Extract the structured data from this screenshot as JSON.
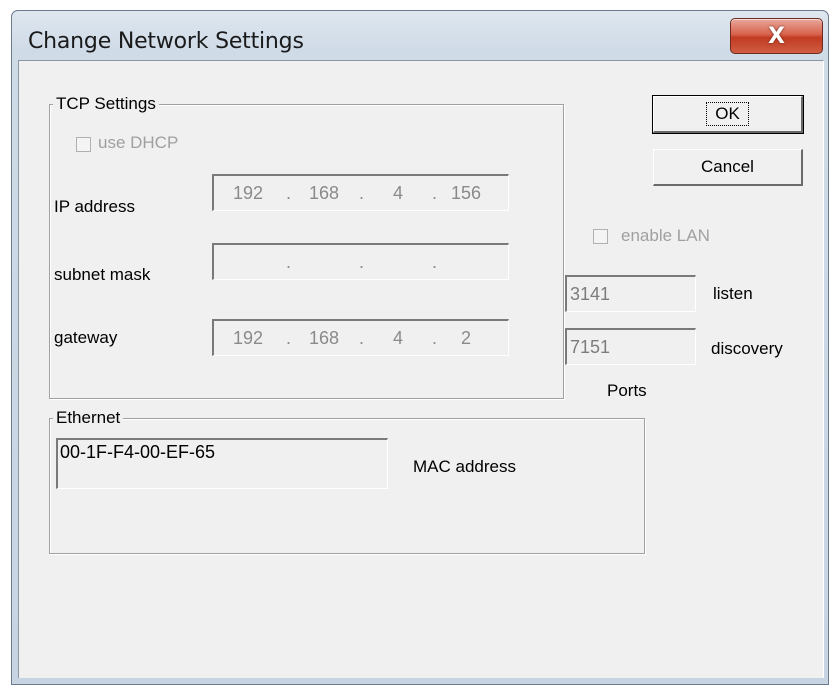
{
  "window": {
    "title": "Change Network Settings",
    "close_label": "X"
  },
  "tcp_settings": {
    "group_title": "TCP Settings",
    "use_dhcp_label": "use DHCP",
    "use_dhcp_checked": false,
    "ip_address": {
      "label": "IP address",
      "octets": [
        "192",
        "168",
        "4",
        "156"
      ]
    },
    "subnet_mask": {
      "label": "subnet mask",
      "octets": [
        "",
        "",
        "",
        ""
      ]
    },
    "gateway": {
      "label": "gateway",
      "octets": [
        "192",
        "168",
        "4",
        "2"
      ]
    }
  },
  "buttons": {
    "ok_label": "OK",
    "cancel_label": "Cancel"
  },
  "lan": {
    "enable_lan_label": "enable LAN",
    "enable_lan_checked": false,
    "listen_port": "3141",
    "listen_label": "listen",
    "discovery_port": "7151",
    "discovery_label": "discovery",
    "ports_label": "Ports"
  },
  "ethernet": {
    "group_title": "Ethernet",
    "mac_address": "00-1F-F4-00-EF-65",
    "mac_label": "MAC address"
  },
  "colors": {
    "dialog_bg": "#f0f0f0",
    "close_button": "#c94a33",
    "disabled_text": "#a0a0a0"
  }
}
